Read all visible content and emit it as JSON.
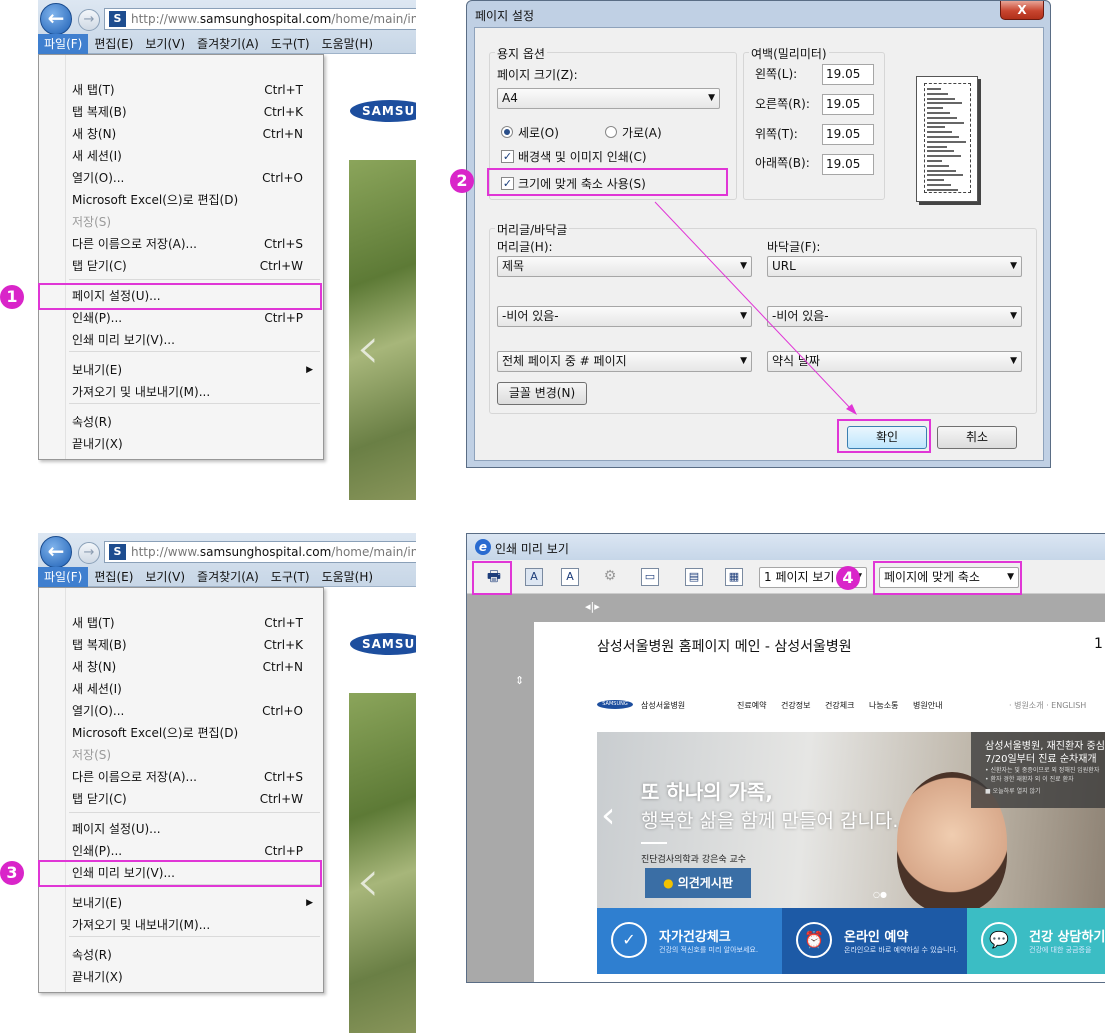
{
  "browser": {
    "url_prefix": "http://www.",
    "url_domain": "samsunghospital.com",
    "url_path": "/home/main/index",
    "favicon": "S",
    "logo": "SAMSUNG",
    "menubar": [
      "파일(F)",
      "편집(E)",
      "보기(V)",
      "즐겨찾기(A)",
      "도구(T)",
      "도움말(H)"
    ]
  },
  "file_menu": [
    {
      "label": "새 탭(T)",
      "shortcut": "Ctrl+T"
    },
    {
      "label": "탭 복제(B)",
      "shortcut": "Ctrl+K"
    },
    {
      "label": "새 창(N)",
      "shortcut": "Ctrl+N"
    },
    {
      "label": "새 세션(I)",
      "shortcut": ""
    },
    {
      "label": "열기(O)...",
      "shortcut": "Ctrl+O"
    },
    {
      "label": "Microsoft Excel(으)로 편집(D)",
      "shortcut": ""
    },
    {
      "label": "저장(S)",
      "shortcut": ""
    },
    {
      "label": "다른 이름으로 저장(A)...",
      "shortcut": "Ctrl+S"
    },
    {
      "label": "탭 닫기(C)",
      "shortcut": "Ctrl+W"
    },
    {
      "label": "페이지 설정(U)...",
      "shortcut": ""
    },
    {
      "label": "인쇄(P)...",
      "shortcut": "Ctrl+P"
    },
    {
      "label": "인쇄 미리 보기(V)...",
      "shortcut": ""
    },
    {
      "label": "보내기(E)",
      "shortcut": ""
    },
    {
      "label": "가져오기 및 내보내기(M)...",
      "shortcut": ""
    },
    {
      "label": "속성(R)",
      "shortcut": ""
    },
    {
      "label": "끝내기(X)",
      "shortcut": ""
    }
  ],
  "steps": [
    "1",
    "2",
    "3",
    "4"
  ],
  "page_setup": {
    "title": "페이지 설정",
    "close": "X",
    "paper_options": "용지 옵션",
    "page_size_label": "페이지 크기(Z):",
    "page_size_value": "A4",
    "portrait": "세로(O)",
    "landscape": "가로(A)",
    "print_background": "배경색 및 이미지 인쇄(C)",
    "shrink_to_fit": "크기에 맞게 축소 사용(S)",
    "margins_title": "여백(밀리미터)",
    "left_label": "왼쪽(L):",
    "right_label": "오른쪽(R):",
    "top_label": "위쪽(T):",
    "bottom_label": "아래쪽(B):",
    "left": "19.05",
    "right": "19.05",
    "top": "19.05",
    "bottom": "19.05",
    "hf_title": "머리글/바닥글",
    "header_label": "머리글(H):",
    "footer_label": "바닥글(F):",
    "header1": "제목",
    "footer1": "URL",
    "header2": "-비어 있음-",
    "footer2": "-비어 있음-",
    "header3": "전체 페이지 중 # 페이지",
    "footer3": "약식 날짜",
    "font_button": "글꼴 변경(N)",
    "ok": "확인",
    "cancel": "취소"
  },
  "print_preview": {
    "title": "인쇄 미리 보기",
    "view_select": "1 페이지 보기",
    "fit_select": "페이지에 맞게 축소",
    "page_title": "삼성서울병원 홈페이지 메인 - 삼성서울병원",
    "page_num": "1",
    "site_logo": "SAMSUNG",
    "site_name": "삼성서울병원",
    "nav": [
      "진료예약",
      "건강정보",
      "건강체크",
      "나눔소통",
      "병원안내"
    ],
    "util": "· 병원소개 · ENGLISH",
    "hero_line1": "또 하나의 가족,",
    "hero_line2": "행복한 삶을 함께 만들어 갑니다.",
    "hero_caption": "진단검사의학과 강은숙 교수",
    "opinion_button": "의견게시판",
    "notice_title1": "삼성서울병원, 재진환자 중심",
    "notice_title2": "7/20일부터 진료 순차재개",
    "notice_line1": "• 신환자는 및 중증이므로 외 정해진 입원환자",
    "notice_line2": "• 환자 경한 재환자 외 이 진료 환자",
    "notice_link": "오늘하루 열지 않기",
    "tiles": [
      {
        "title": "자가건강체크",
        "sub": "건강의 적신호를 미리 알아보세요.",
        "color": "#2f7fd0"
      },
      {
        "title": "온라인 예약",
        "sub": "온라인으로 바로 예약하실 수 있습니다.",
        "color": "#1d5aa6"
      },
      {
        "title": "건강 상담하기",
        "sub": "건강에 대한 궁금증을",
        "color": "#3bbdc4"
      }
    ]
  }
}
